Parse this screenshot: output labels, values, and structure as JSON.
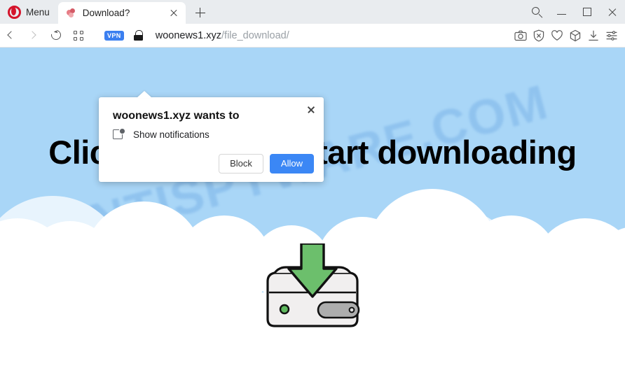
{
  "browser": {
    "menu_label": "Menu",
    "opera_logo_color": "#d4142b",
    "tab": {
      "title": "Download?",
      "close_icon": "close-icon",
      "favicon": "page-favicon"
    },
    "new_tab_icon": "plus-icon",
    "window_controls": {
      "search_icon": "search-icon",
      "minimize_icon": "minimize-icon",
      "maximize_icon": "maximize-icon",
      "close_icon": "close-icon"
    },
    "toolbar": {
      "back_icon": "chevron-left-icon",
      "forward_icon": "chevron-right-icon",
      "reload_icon": "reload-icon",
      "tabs_grid_icon": "grid-icon",
      "vpn_badge": "VPN",
      "vpn_badge_color": "#3b7ff0",
      "lock_icon": "lock-icon",
      "url_host": "woonews1.xyz",
      "url_path": "/file_download/",
      "right_icons": [
        {
          "name": "camera-snapshot-icon"
        },
        {
          "name": "ad-blocker-shield-icon"
        },
        {
          "name": "heart-icon"
        },
        {
          "name": "crypto-wallet-cube-icon"
        },
        {
          "name": "downloads-icon"
        },
        {
          "name": "easy-setup-sliders-icon"
        }
      ]
    }
  },
  "dialog": {
    "title": "woonews1.xyz wants to",
    "permission_label": "Show notifications",
    "permission_icon": "notification-icon",
    "close_icon": "close-icon",
    "block_label": "Block",
    "allow_label": "Allow",
    "allow_color": "#3b87f5"
  },
  "page": {
    "headline": "Click \"Allow\" to start downloading",
    "watermark": "MYANTISPYWARE.COM",
    "background_color": "#a9d6f7",
    "illustration": {
      "name": "download-to-harddrive-illustration",
      "arrow_color": "#6cbf6c",
      "drive_color": "#f0eeee",
      "led_color": "#5fb95f",
      "slot_color": "#a9a9a9"
    }
  }
}
